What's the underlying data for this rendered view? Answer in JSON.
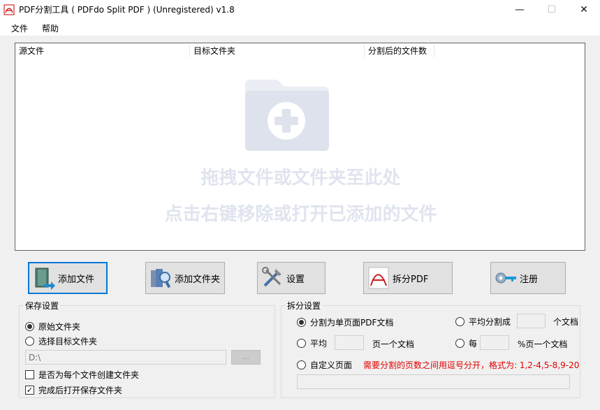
{
  "window": {
    "title": "PDF分割工具 ( PDFdo Split PDF ) (Unregistered) v1.8",
    "controls": {
      "minimize": "—",
      "maximize": "☐",
      "close": "✕"
    }
  },
  "menu": {
    "items": [
      {
        "label": "文件"
      },
      {
        "label": "帮助"
      }
    ]
  },
  "file_list": {
    "columns": [
      "源文件",
      "目标文件夹",
      "分割后的文件数"
    ],
    "drop_hint_line1": "拖拽文件或文件夹至此处",
    "drop_hint_line2": "点击右键移除或打开已添加的文件"
  },
  "toolbar": {
    "add_file": "添加文件",
    "add_folder": "添加文件夹",
    "settings": "设置",
    "split_pdf": "拆分PDF",
    "register": "注册"
  },
  "save_settings": {
    "group_label": "保存设置",
    "option_original": "原始文件夹",
    "option_target": "选择目标文件夹",
    "selected": "original",
    "path_value": "D:\\",
    "browse_label": "...",
    "create_folder_each": "是否为每个文件创建文件夹",
    "create_folder_each_checked": false,
    "open_after_done": "完成后打开保存文件夹",
    "open_after_done_checked": true
  },
  "split_settings": {
    "group_label": "拆分设置",
    "option_single_page": "分割为单页面PDF文档",
    "option_average_split": "平均分割成",
    "unit_documents": "个文档",
    "option_average": "平均",
    "unit_pages_per_doc": "页一个文档",
    "option_every": "每",
    "unit_percent_pages": "%页一个文档",
    "option_custom": "自定义页面",
    "custom_hint": "需要分割的页数之间用逗号分开，格式为: 1,2-4,5-8,9-20",
    "selected": "single_page",
    "average_split_value": "",
    "average_value": "",
    "every_value": "",
    "custom_value": ""
  },
  "colors": {
    "accent": "#0078d7",
    "hint_red": "#e00000",
    "watermark": "#dfe4ee"
  }
}
